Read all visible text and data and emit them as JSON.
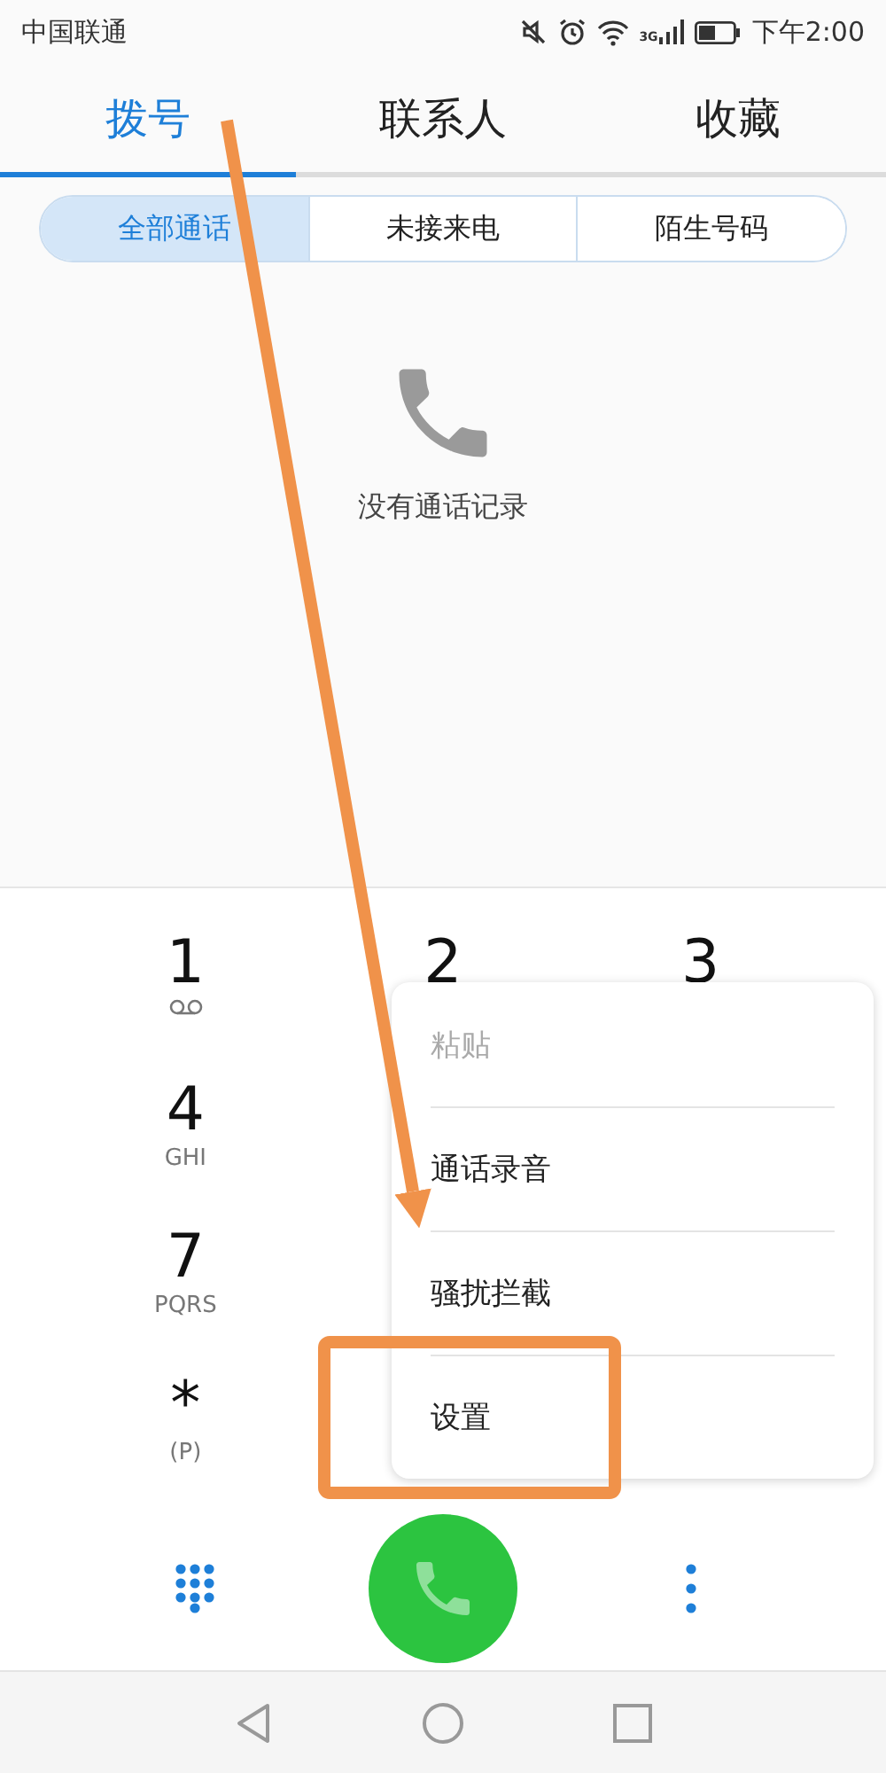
{
  "status_bar": {
    "carrier": "中国联通",
    "network": "3G",
    "time": "下午2:00"
  },
  "tabs": [
    {
      "label": "拨号",
      "selected": true
    },
    {
      "label": "联系人",
      "selected": false
    },
    {
      "label": "收藏",
      "selected": false
    }
  ],
  "filters": [
    {
      "label": "全部通话",
      "selected": true
    },
    {
      "label": "未接来电",
      "selected": false
    },
    {
      "label": "陌生号码",
      "selected": false
    }
  ],
  "empty_state": {
    "message": "没有通话记录"
  },
  "keypad": {
    "rows": [
      {
        "keys": [
          {
            "digit": "1",
            "kind": "voicemail"
          },
          {
            "digit": "2"
          },
          {
            "digit": "3"
          }
        ]
      },
      {
        "keys": [
          {
            "digit": "4",
            "letters": "GHI"
          }
        ]
      },
      {
        "keys": [
          {
            "digit": "7",
            "letters": "PQRS"
          }
        ]
      },
      {
        "keys": [
          {
            "digit": "*",
            "letters": "(P)"
          }
        ]
      }
    ]
  },
  "menu": {
    "items": [
      {
        "label": "粘贴",
        "disabled": true
      },
      {
        "label": "通话录音",
        "disabled": false
      },
      {
        "label": "骚扰拦截",
        "disabled": false
      },
      {
        "label": "设置",
        "disabled": false
      }
    ]
  }
}
